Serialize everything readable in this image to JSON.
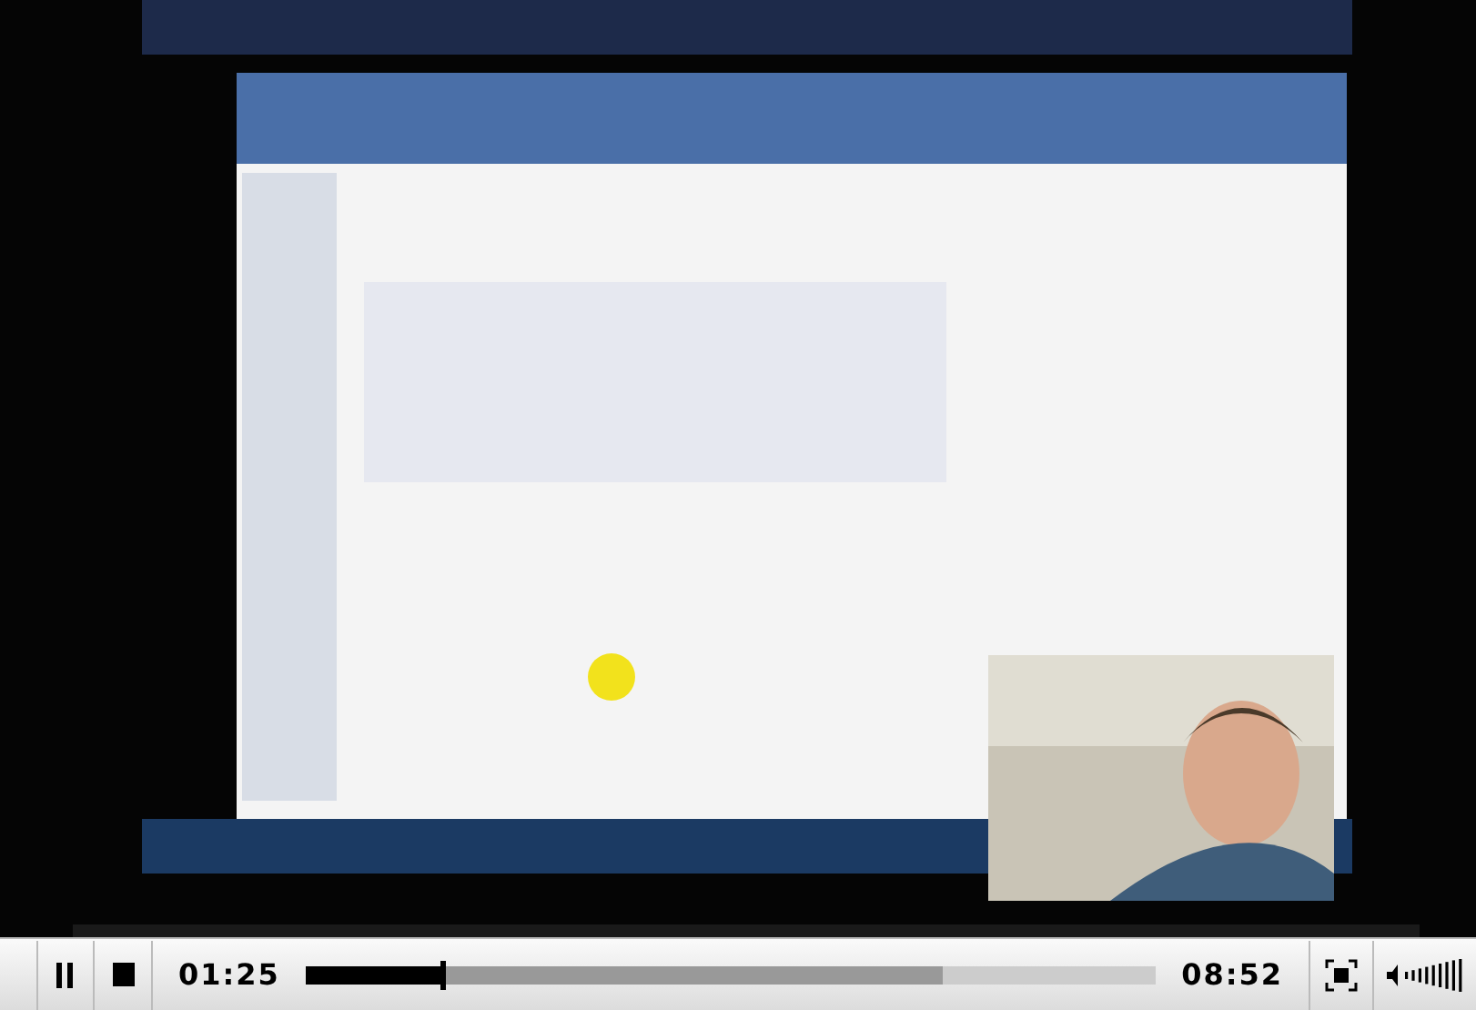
{
  "controls": {
    "playing": true,
    "elapsed": "01:25",
    "progress": {
      "level": 0.16,
      "buffered": {
        "level": 0.75
      }
    },
    "duration": "08:52"
  }
}
